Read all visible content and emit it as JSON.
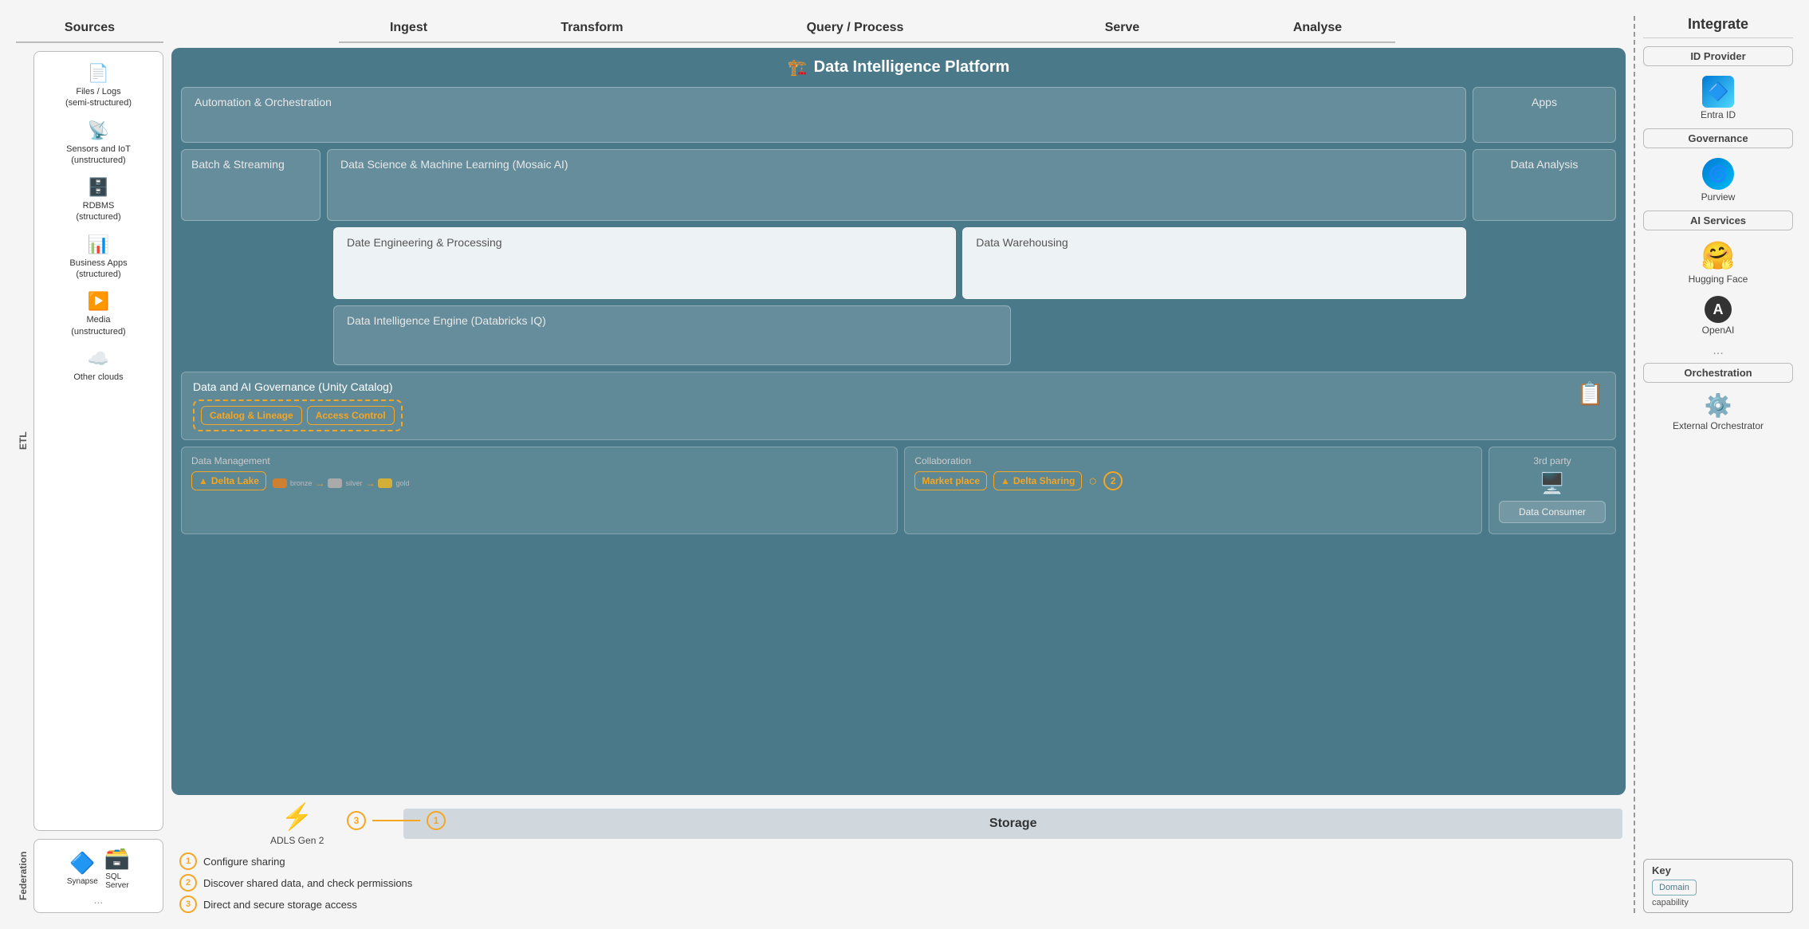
{
  "header": {
    "sources": "Sources",
    "ingest": "Ingest",
    "transform": "Transform",
    "query_process": "Query / Process",
    "serve": "Serve",
    "analyse": "Analyse",
    "integrate": "Integrate"
  },
  "sources": {
    "items": [
      {
        "icon": "📄",
        "label": "Files / Logs\n(semi-structured)"
      },
      {
        "icon": "📡",
        "label": "Sensors and IoT\n(unstructured)"
      },
      {
        "icon": "🗄️",
        "label": "RDBMS\n(structured)"
      },
      {
        "icon": "📊",
        "label": "Business Apps\n(structured)"
      },
      {
        "icon": "▶️",
        "label": "Media\n(unstructured)"
      },
      {
        "icon": "☁️",
        "label": "Other clouds"
      }
    ],
    "etl_label": "ETL"
  },
  "federation": {
    "label": "Federation",
    "items": [
      "Synapse",
      "SQL Server",
      "..."
    ]
  },
  "platform": {
    "title": "Data Intelligence Platform",
    "icon": "🏗️",
    "rows": {
      "automation": "Automation & Orchestration",
      "apps": "Apps",
      "batch": "Batch & Streaming",
      "dsml": "Data Science & Machine Learning  (Mosaic AI)",
      "data_analysis": "Data Analysis",
      "engineering": "Date Engineering & Processing",
      "warehousing": "Data Warehousing",
      "engine": "Data Intelligence Engine  (Databricks IQ)",
      "governance_title": "Data and AI Governance  (Unity Catalog)",
      "catalog_lineage": "Catalog &\nLineage",
      "access_control": "Access Control",
      "mgmt_title": "Data Management",
      "collab_title": "Collaboration",
      "third_party_title": "3rd party",
      "delta_lake": "Delta\nLake",
      "marketplace": "Market\nplace",
      "delta_sharing": "Delta\nSharing",
      "data_consumer": "Data Consumer",
      "bronze": "bronze",
      "silver": "silver",
      "gold": "gold"
    }
  },
  "storage": {
    "adls_label": "ADLS Gen 2",
    "storage_label": "Storage"
  },
  "steps": [
    {
      "num": "1",
      "text": "Configure sharing"
    },
    {
      "num": "2",
      "text": "Discover shared data, and check permissions"
    },
    {
      "num": "3",
      "text": "Direct and secure storage access"
    }
  ],
  "integrate": {
    "title": "Integrate",
    "sections": [
      {
        "label": "ID Provider",
        "items": [
          {
            "icon": "🔷",
            "name": "Entra ID",
            "color": "#0078d4"
          }
        ]
      },
      {
        "label": "Governance",
        "items": [
          {
            "icon": "🌀",
            "name": "Purview",
            "color": "#0078d4"
          }
        ]
      },
      {
        "label": "AI Services",
        "items": [
          {
            "icon": "🤗",
            "name": "Hugging Face",
            "color": "#ff9900"
          },
          {
            "icon": "◉",
            "name": "OpenAI",
            "color": "#333"
          }
        ]
      },
      {
        "label": "Orchestration",
        "items": [
          {
            "icon": "⚙️",
            "name": "External\nOrchestrator",
            "color": "#555"
          }
        ]
      }
    ],
    "dots": "...",
    "key_title": "Key",
    "key_domain": "Domain",
    "key_capability": "capability"
  }
}
